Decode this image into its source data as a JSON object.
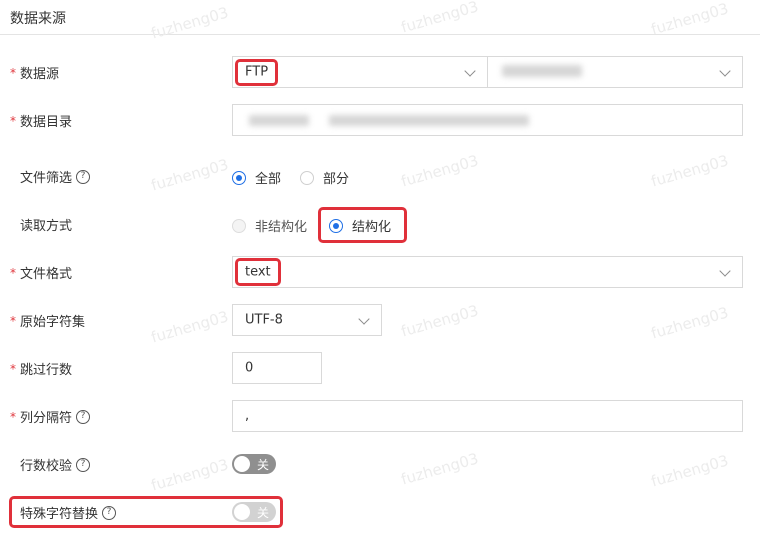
{
  "section": {
    "title": "数据来源"
  },
  "watermark": "fuzheng03",
  "fields": {
    "datasource": {
      "label": "数据源",
      "type_value": "FTP",
      "connection_value": ""
    },
    "directory": {
      "label": "数据目录",
      "value": ""
    },
    "file_filter": {
      "label": "文件筛选",
      "options": [
        "全部",
        "部分"
      ],
      "selected": "全部"
    },
    "read_mode": {
      "label": "读取方式",
      "options": [
        "非结构化",
        "结构化"
      ],
      "selected": "结构化"
    },
    "file_format": {
      "label": "文件格式",
      "value": "text"
    },
    "charset": {
      "label": "原始字符集",
      "value": "UTF-8"
    },
    "skip_rows": {
      "label": "跳过行数",
      "value": "0"
    },
    "column_separator": {
      "label": "列分隔符",
      "value": ","
    },
    "row_check": {
      "label": "行数校验",
      "toggle_text": "关",
      "on": false
    },
    "special_char_replace": {
      "label": "特殊字符替换",
      "toggle_text": "关",
      "on": false
    }
  },
  "colors": {
    "accent": "#1f6fe5",
    "required": "#e0383e",
    "highlight": "#e0303a"
  },
  "icons": {
    "select_arrow": "chevron-down-icon",
    "help": "help-circle-icon"
  }
}
